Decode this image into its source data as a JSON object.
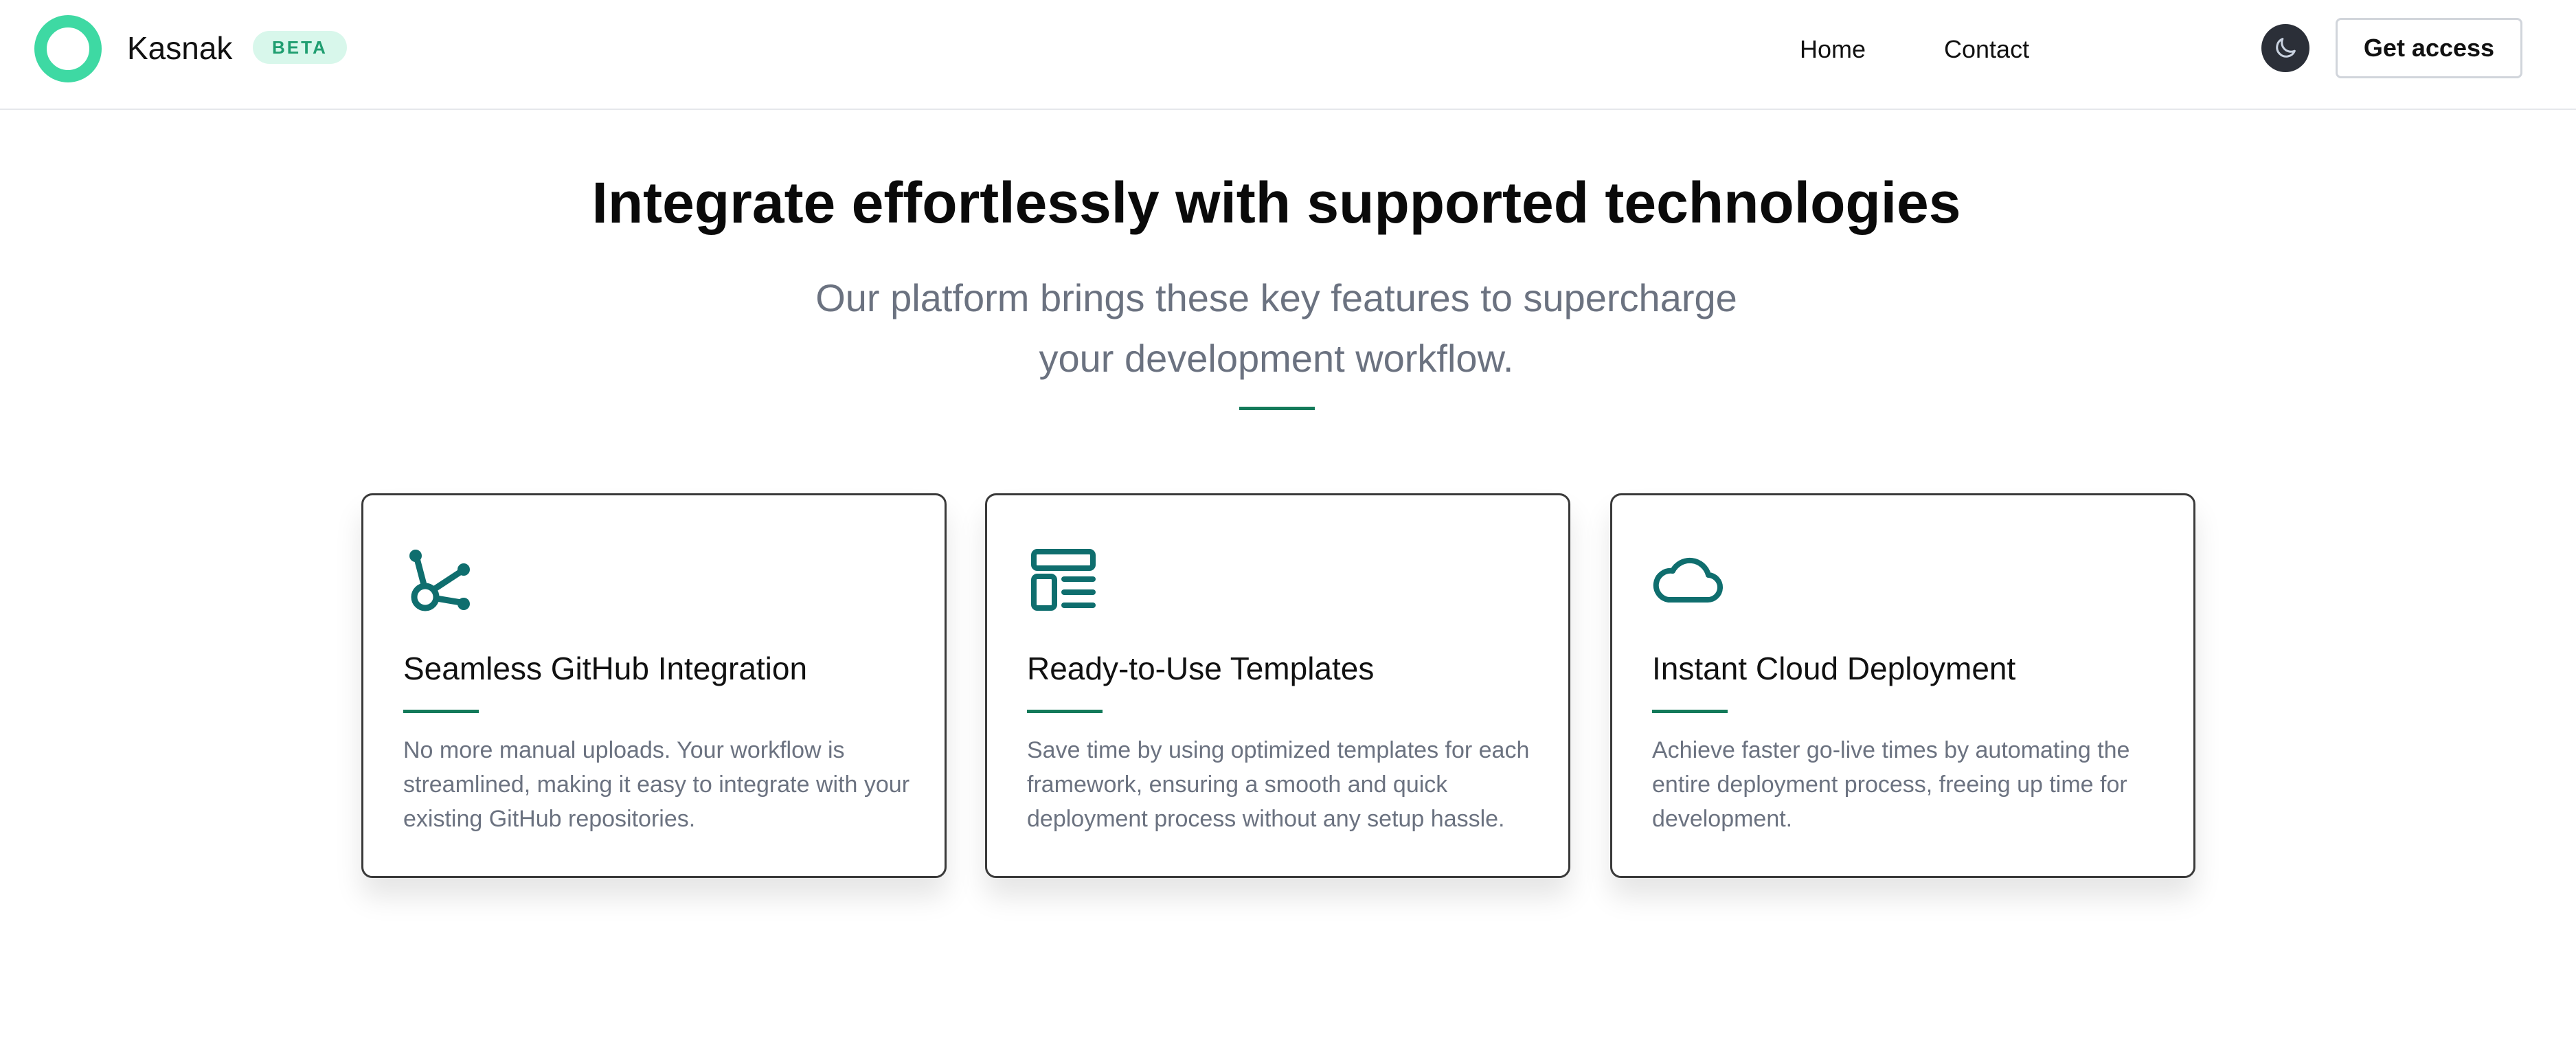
{
  "header": {
    "brand": "Kasnak",
    "badge": "BETA",
    "nav": [
      "Home",
      "Contact"
    ],
    "cta_label": "Get access"
  },
  "hero": {
    "title": "Integrate effortlessly with supported technologies",
    "subtitle": "Our platform brings these key features to supercharge your development workflow."
  },
  "features": [
    {
      "icon": "git-branch-icon",
      "title": "Seamless GitHub Integration",
      "description": "No more manual uploads. Your workflow is streamlined, making it easy to integrate with your existing GitHub repositories."
    },
    {
      "icon": "template-layout-icon",
      "title": "Ready-to-Use Templates",
      "description": "Save time by using optimized templates for each framework, ensuring a smooth and quick deployment process without any setup hassle."
    },
    {
      "icon": "cloud-icon",
      "title": "Instant Cloud Deployment",
      "description": "Achieve faster go-live times by automating the entire deployment process, freeing up time for development."
    }
  ],
  "colors": {
    "logo_accent": "#3ed9a3",
    "badge_bg": "#d8f7eb",
    "badge_text": "#1f9e70",
    "divider": "#137a5a",
    "icon": "#0f6e6e",
    "toggle_bg": "#2b2f38"
  }
}
